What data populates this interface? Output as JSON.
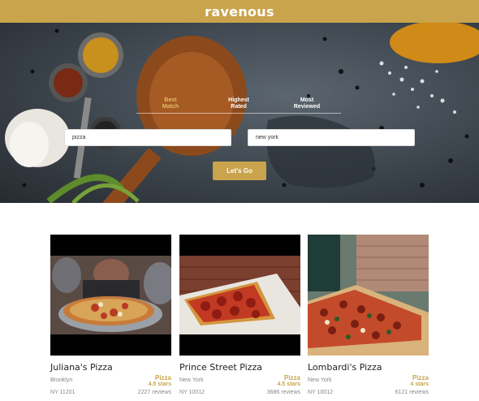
{
  "header": {
    "logo": "ravenous"
  },
  "search": {
    "sort_options": [
      {
        "line1": "Best",
        "line2": "Match",
        "active": true
      },
      {
        "line1": "Highest",
        "line2": "Rated",
        "active": false
      },
      {
        "line1": "Most",
        "line2": "Reviewed",
        "active": false
      }
    ],
    "term_value": "pizza",
    "location_value": "new york",
    "submit_label": "Let's Go"
  },
  "businesses": [
    {
      "name": "Juliana's Pizza",
      "category": "Pizza",
      "city": "Brooklyn",
      "zip": "NY 11201",
      "rating": "4.5 stars",
      "reviews": "2227 reviews"
    },
    {
      "name": "Prince Street Pizza",
      "category": "Pizza",
      "city": "New York",
      "zip": "NY 10012",
      "rating": "4.5 stars",
      "reviews": "3686 reviews"
    },
    {
      "name": "Lombardi's Pizza",
      "category": "Pizza",
      "city": "New York",
      "zip": "NY 10012",
      "rating": "4 stars",
      "reviews": "6121 reviews"
    }
  ],
  "colors": {
    "accent": "#c9a44c",
    "hero_dark": "#3c444c"
  }
}
